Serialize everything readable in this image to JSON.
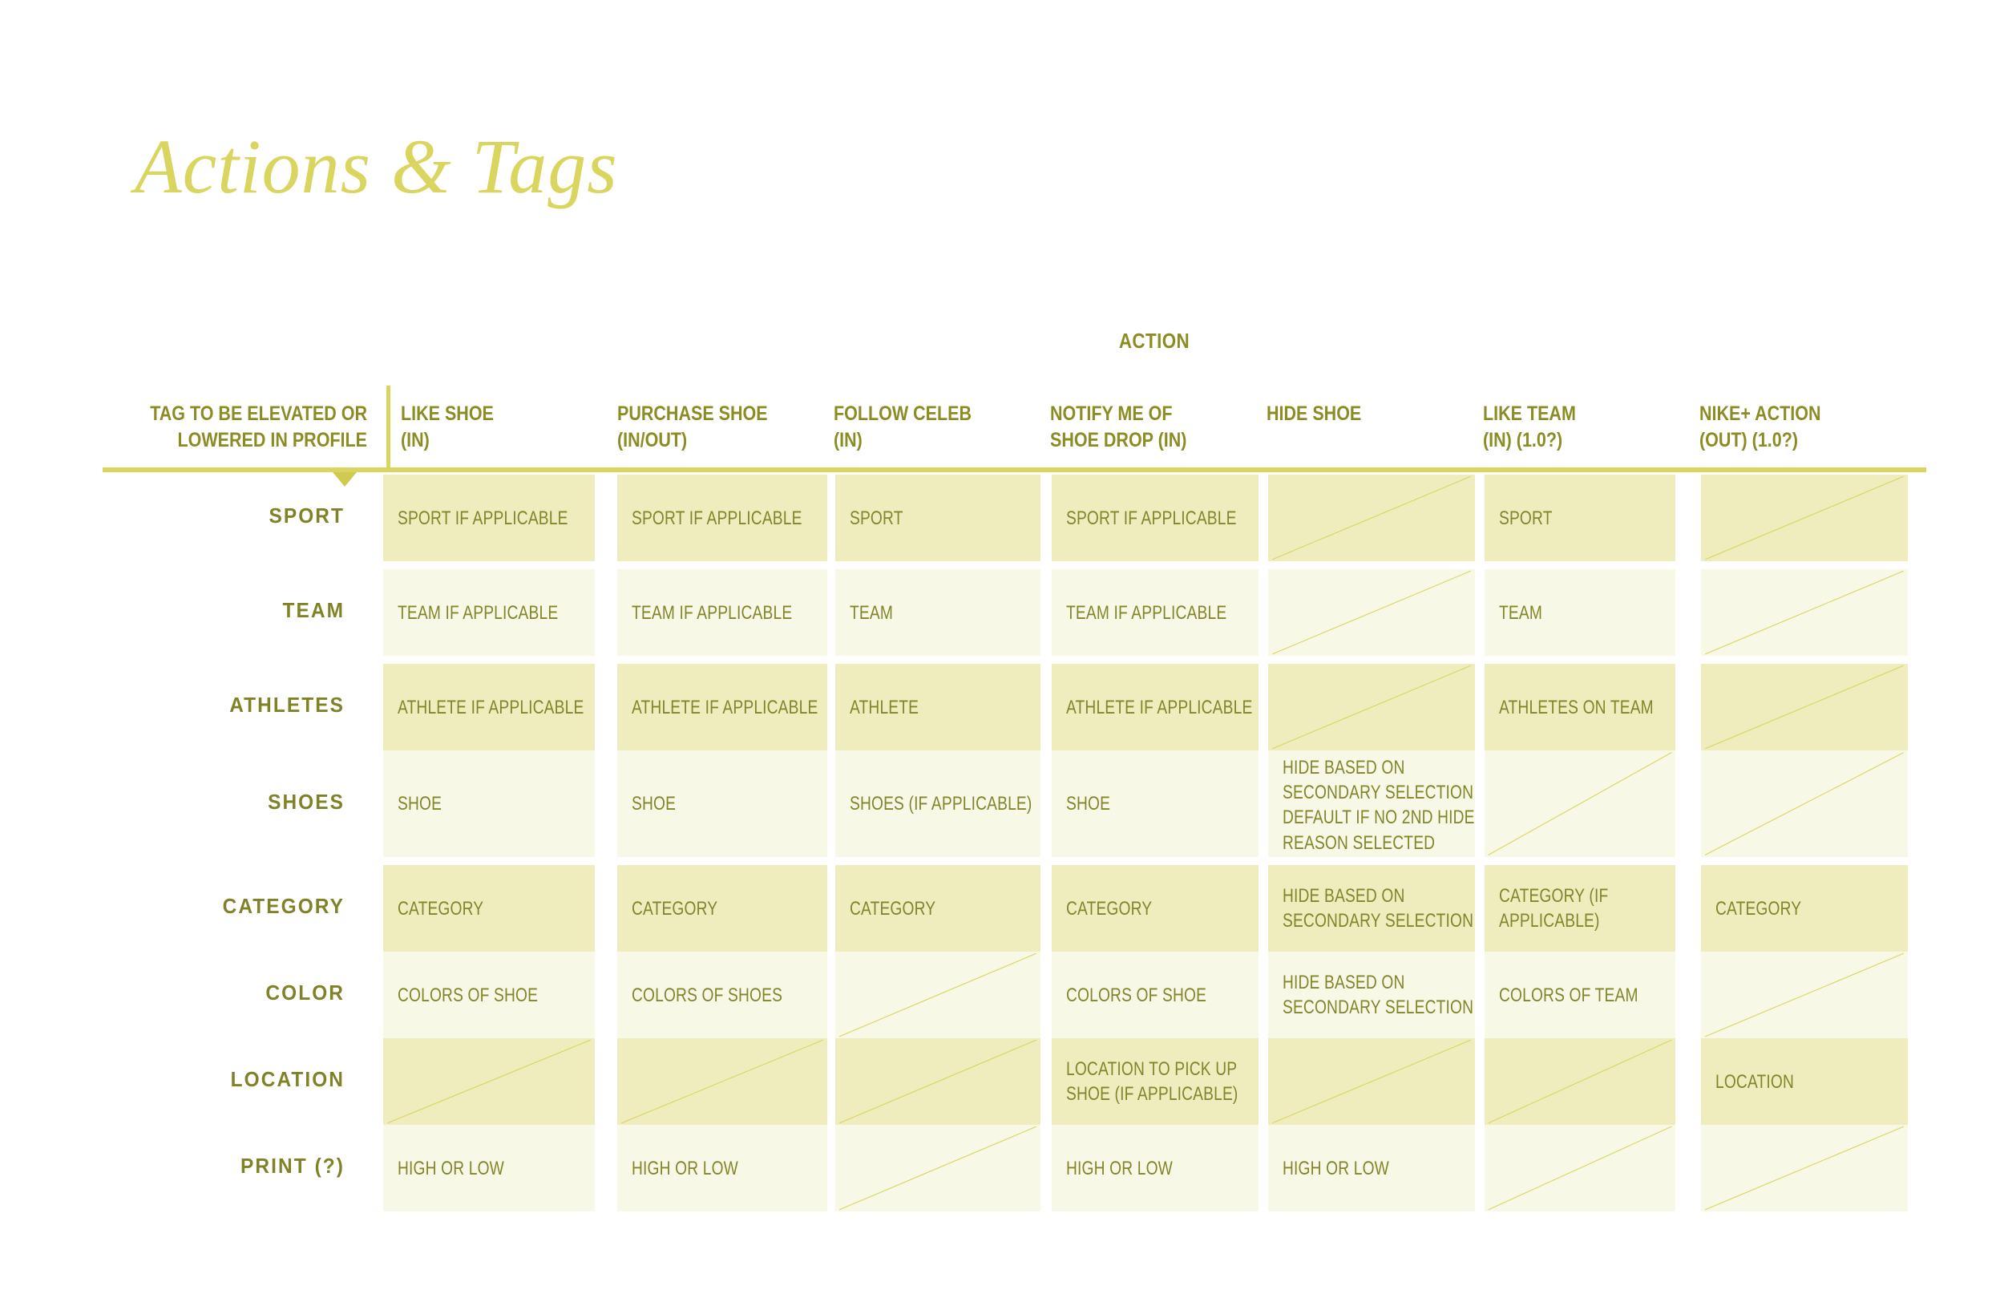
{
  "title": "Actions & Tags",
  "colors": {
    "title": "#D9D55F",
    "heading": "#8B8C24",
    "cell_text": "#82852A",
    "cell_dark": "#EFEDBE",
    "cell_light": "#F8F8E7",
    "rule": "#D9D55F"
  },
  "table": {
    "action_group_label": "ACTION",
    "row_header_label": "TAG TO BE ELEVATED OR\nLOWERED IN PROFILE",
    "columns": [
      {
        "label": "LIKE SHOE\n(IN)"
      },
      {
        "label": "PURCHASE SHOE\n(IN/OUT)"
      },
      {
        "label": "FOLLOW CELEB\n(IN)"
      },
      {
        "label": "NOTIFY ME OF\nSHOE DROP (IN)"
      },
      {
        "label": "HIDE SHOE"
      },
      {
        "label": "LIKE TEAM\n(IN) (1.0?)"
      },
      {
        "label": "NIKE+ ACTION\n(OUT) (1.0?)"
      }
    ],
    "rows": [
      {
        "label": "SPORT",
        "cells": [
          "SPORT IF APPLICABLE",
          "SPORT IF APPLICABLE",
          "SPORT",
          "SPORT IF APPLICABLE",
          "",
          "SPORT",
          ""
        ]
      },
      {
        "label": "TEAM",
        "cells": [
          "TEAM IF APPLICABLE",
          "TEAM IF APPLICABLE",
          "TEAM",
          "TEAM IF APPLICABLE",
          "",
          "TEAM",
          ""
        ]
      },
      {
        "label": "ATHLETES",
        "cells": [
          "ATHLETE IF APPLICABLE",
          "ATHLETE IF APPLICABLE",
          "ATHLETE",
          "ATHLETE IF APPLICABLE",
          "",
          "ATHLETES ON TEAM",
          ""
        ]
      },
      {
        "label": "SHOES",
        "cells": [
          "SHOE",
          "SHOE",
          "SHOES (IF APPLICABLE)",
          "SHOE",
          "HIDE BASED ON SECONDARY SELECTION - DEFAULT IF NO 2ND HIDE REASON SELECTED",
          "",
          ""
        ]
      },
      {
        "label": "CATEGORY",
        "cells": [
          "CATEGORY",
          "CATEGORY",
          "CATEGORY",
          "CATEGORY",
          "HIDE BASED ON SECONDARY SELECTION",
          "CATEGORY (IF APPLICABLE)",
          "CATEGORY"
        ]
      },
      {
        "label": "COLOR",
        "cells": [
          "COLORS OF SHOE",
          "COLORS OF SHOES",
          "",
          "COLORS OF SHOE",
          "HIDE BASED ON SECONDARY SELECTION",
          "COLORS OF TEAM",
          ""
        ]
      },
      {
        "label": "LOCATION",
        "cells": [
          "",
          "",
          "",
          "LOCATION TO PICK UP SHOE (IF APPLICABLE)",
          "",
          "",
          "LOCATION"
        ]
      },
      {
        "label": "PRINT (?)",
        "cells": [
          "HIGH OR LOW",
          "HIGH OR LOW",
          "",
          "HIGH OR LOW",
          "HIGH OR LOW",
          "",
          ""
        ]
      }
    ]
  }
}
